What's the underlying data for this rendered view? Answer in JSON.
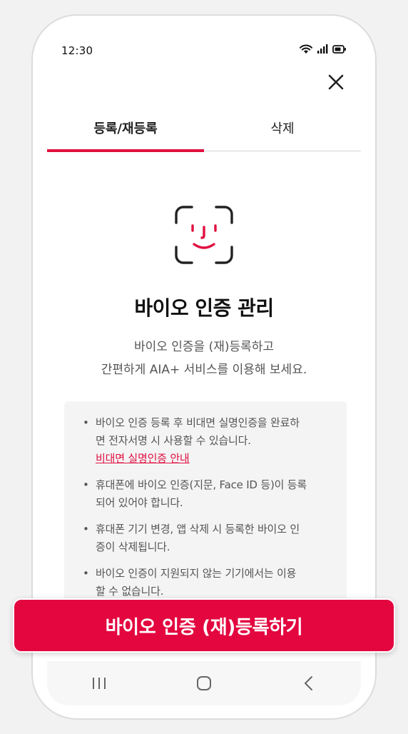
{
  "status_bar": {
    "time": "12:30",
    "icons": [
      "wifi-icon",
      "signal-icon",
      "battery-icon"
    ]
  },
  "tabs": [
    {
      "label": "등록/재등록",
      "active": true
    },
    {
      "label": "삭제",
      "active": false
    }
  ],
  "content": {
    "title": "바이오 인증 관리",
    "subtitle_lines": [
      "바이오 인증을 (재)등록하고",
      "간편하게 AIA+ 서비스를 이용해 보세요."
    ]
  },
  "info": {
    "items": [
      {
        "lines": [
          "바이오 인증 등록 후 비대면 실명인증을 완료하",
          "면 전자서명 시 사용할 수 있습니다."
        ],
        "link": "비대면 실명인증 안내"
      },
      {
        "lines": [
          "휴대폰에 바이오 인증(지문, Face ID 등)이 등록",
          "되어 있어야 합니다."
        ]
      },
      {
        "lines": [
          "휴대폰 기기 변경, 앱 삭제 시 등록한 바이오 인",
          "증이 삭제됩니다."
        ]
      },
      {
        "lines": [
          "바이오 인증이 지원되지 않는 기기에서는 이용",
          "할 수 없습니다."
        ]
      }
    ]
  },
  "cta": {
    "label": "바이오 인증 (재)등록하기"
  },
  "colors": {
    "accent": "#e3063f",
    "text": "#111111",
    "muted": "#555555"
  }
}
